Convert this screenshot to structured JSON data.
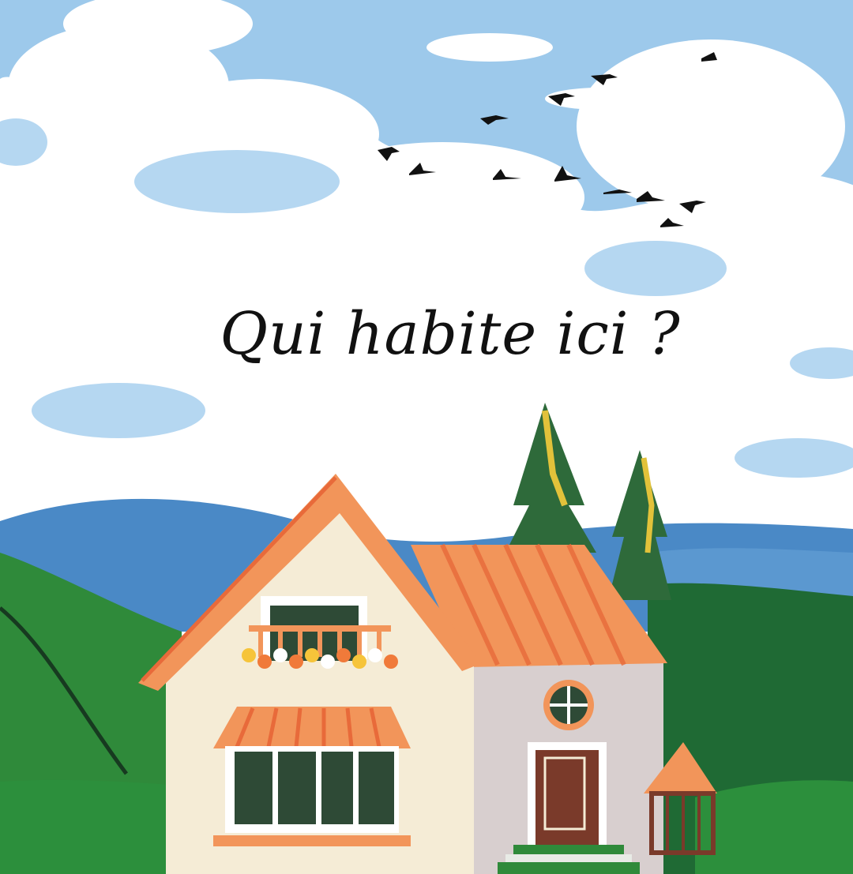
{
  "title": "Qui habite ici ?",
  "colors": {
    "sky": "#7fb6e3",
    "cloud": "#ffffff",
    "mountain": "#4a8ac8",
    "hill": "#2f8a3a",
    "roof": "#f2955a",
    "wall_front": "#f5ecd6",
    "wall_side": "#d8cfcf",
    "door": "#7a3a2a",
    "window": "#2e4a36",
    "tree": "#2e6a3a"
  },
  "icons": [
    "bird-icon",
    "tree-icon",
    "house-icon",
    "cloud-icon"
  ]
}
